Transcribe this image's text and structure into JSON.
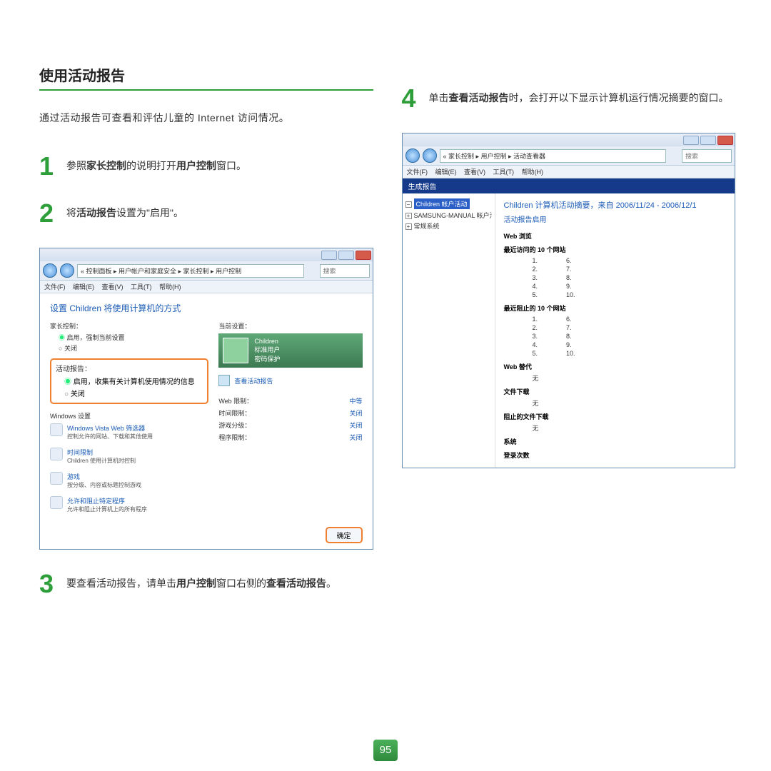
{
  "heading": "使用活动报告",
  "intro": "通过活动报告可查看和评估儿童的 Internet 访问情况。",
  "steps": {
    "s1": {
      "num": "1",
      "pre": "参照",
      "b1": "家长控制",
      "mid": "的说明打开",
      "b2": "用户控制",
      "post": "窗口。"
    },
    "s2": {
      "num": "2",
      "pre": "将",
      "b1": "活动报告",
      "post": "设置为\"启用\"。"
    },
    "s3": {
      "num": "3",
      "pre": "要查看活动报告，请单击",
      "b1": "用户控制",
      "mid": "窗口右侧的",
      "b2": "查看活动报告",
      "post": "。"
    },
    "s4": {
      "num": "4",
      "pre": "单击",
      "b1": "查看活动报告",
      "post": "时，会打开以下显示计算机运行情况摘要的窗口。"
    }
  },
  "win1": {
    "breadcrumb": "« 控制面板 ▸ 用户帐户和家庭安全 ▸ 家长控制 ▸ 用户控制",
    "search": "搜索",
    "menu": {
      "file": "文件(F)",
      "edit": "编辑(E)",
      "view": "查看(V)",
      "tools": "工具(T)",
      "help": "帮助(H)"
    },
    "title": "设置 Children 将使用计算机的方式",
    "left": {
      "g1": "家长控制：",
      "g1a": "启用，强制当前设置",
      "g1b": "关闭",
      "g2": "活动报告：",
      "g2a": "启用，收集有关计算机使用情况的信息",
      "g2b": "关闭",
      "wset": "Windows 设置",
      "l1t": "Windows Vista Web 筛选器",
      "l1d": "控制允许的网站、下载和其他使用",
      "l2t": "时间限制",
      "l2d": "Children 使用计算机时控制",
      "l3t": "游戏",
      "l3d": "按分级、内容或标题控制游戏",
      "l4t": "允许和阻止特定程序",
      "l4d": "允许和阻止计算机上的所有程序"
    },
    "right": {
      "cur": "当前设置：",
      "user": "Children",
      "utype": "标准用户",
      "uprot": "密码保护",
      "viewrep": "查看活动报告",
      "k1": "Web 限制：",
      "v1": "中等",
      "k2": "时间限制：",
      "v2": "关闭",
      "k3": "游戏分级：",
      "v3": "关闭",
      "k4": "程序限制：",
      "v4": "关闭"
    },
    "ok": "确定"
  },
  "win2": {
    "breadcrumb": "« 家长控制 ▸ 用户控制 ▸ 活动查看器",
    "search": "搜索",
    "menu": {
      "file": "文件(F)",
      "edit": "编辑(E)",
      "view": "查看(V)",
      "tools": "工具(T)",
      "help": "帮助(H)"
    },
    "bluebar": "生成报告",
    "tree": {
      "n1": "Children 帐户活动",
      "n2": "SAMSUNG-MANUAL 帐户活动",
      "n3": "常规系统"
    },
    "report": {
      "title": "Children 计算机活动摘要，来自 2006/11/24 - 2006/12/1",
      "sub": "活动报告启用",
      "sWeb": "Web 浏览",
      "sTop": "最近访问的 10 个网站",
      "sBlocked": "最近阻止的 10 个网站",
      "colA": [
        "1.",
        "2.",
        "3.",
        "4.",
        "5."
      ],
      "colB": [
        "6.",
        "7.",
        "8.",
        "9.",
        "10."
      ],
      "sOverride": "Web 替代",
      "none": "无",
      "sDownload": "文件下载",
      "sBlockedDl": "阻止的文件下载",
      "sSystem": "系统",
      "sLogon": "登录次数"
    }
  },
  "pagenum": "95"
}
